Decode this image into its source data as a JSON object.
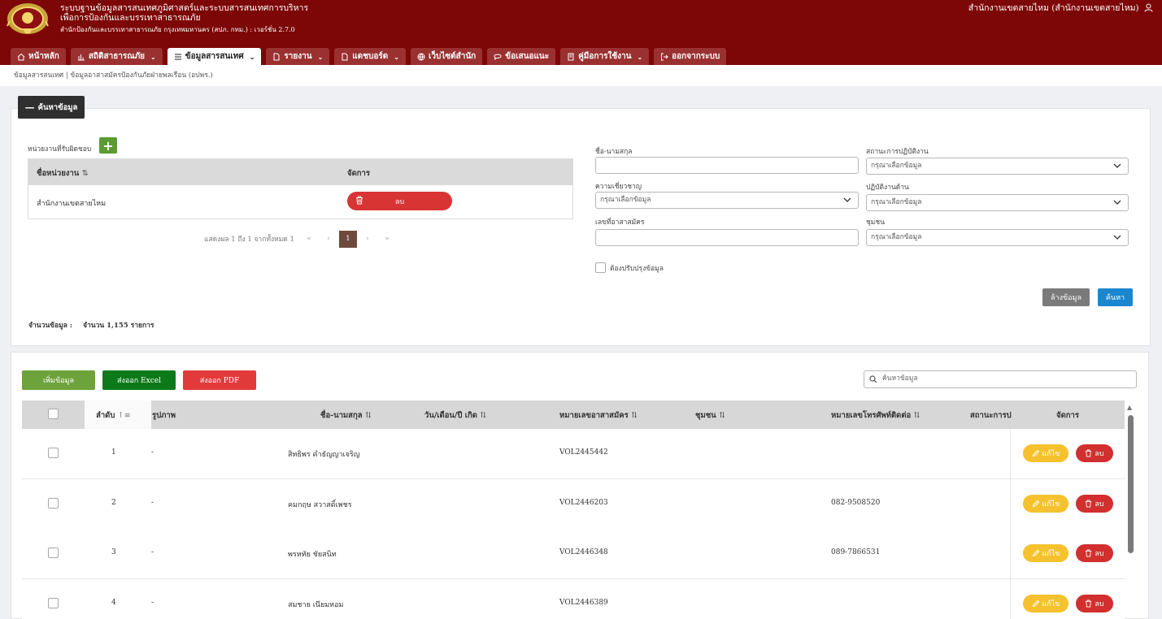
{
  "header": {
    "title_line1": "ระบบฐานข้อมูลสารสนเทศภูมิศาสตร์และระบบสารสนเทศการบริหาร",
    "title_line2": "เพื่อการป้องกันและบรรเทาสาธารณภัย",
    "subtitle": "สำนักป้องกันและบรรเทาสาธารณภัย กรุงเทพมหานคร (สปภ. กทม.) : เวอร์ชั่น 2.7.0",
    "user": "สำนักงานเขตสายไหม (สำนักงานเขตสายไหม)",
    "brand_color": "#7d0606"
  },
  "nav": [
    {
      "label": "หน้าหลัก",
      "icon": "home-icon",
      "dropdown": false,
      "active": false
    },
    {
      "label": "สถิติสาธารณภัย",
      "icon": "bar-chart-icon",
      "dropdown": true,
      "active": false
    },
    {
      "label": "ข้อมูลสารสนเทศ",
      "icon": "list-icon",
      "dropdown": true,
      "active": true
    },
    {
      "label": "รายงาน",
      "icon": "file-icon",
      "dropdown": true,
      "active": false
    },
    {
      "label": "แดชบอร์ด",
      "icon": "file-icon",
      "dropdown": true,
      "active": false
    },
    {
      "label": "เว็บไซต์สำนัก",
      "icon": "globe-icon",
      "dropdown": false,
      "active": false
    },
    {
      "label": "ข้อเสนอแนะ",
      "icon": "comment-icon",
      "dropdown": false,
      "active": false
    },
    {
      "label": "คู่มือการใช้งาน",
      "icon": "book-icon",
      "dropdown": true,
      "active": false
    },
    {
      "label": "ออกจากระบบ",
      "icon": "logout-icon",
      "dropdown": false,
      "active": false
    }
  ],
  "breadcrumb": "ข้อมูลสารสนเทศ | ข้อมูลอาสาสมัครป้องกันภัยฝ่ายพลเรือน (อปพร.)",
  "search": {
    "toggle_label": "ค้นหาข้อมูล",
    "unit_label": "หน่วยงานที่รับผิดชอบ",
    "unit_table": {
      "col_name": "ชื่อหน่วยงาน",
      "col_action": "จัดการ",
      "row_name": "สำนักงานเขตสายไหม",
      "delete_label": "ลบ"
    },
    "pager": {
      "info": "แสดงผล 1 ถึง 1 จากทั้งหมด 1",
      "first": "«",
      "prev": "‹",
      "current": "1",
      "next": "›",
      "last": "»"
    },
    "total_label": "จำนวนข้อมูล :",
    "total_value": "จำนวน 1,155 รายการ",
    "fields": {
      "name_label": "ชื่อ-นามสกุล",
      "status_label": "สถานะการปฏิบัติงาน",
      "status_placeholder": "กรุณาเลือกข้อมูล",
      "skill_label": "ความเชี่ยวชาญ",
      "skill_placeholder": "กรุณาเลือกข้อมูล",
      "duty_label": "ปฏิบัติงานด้าน",
      "duty_placeholder": "กรุณาเลือกข้อมูล",
      "volunteer_no_label": "เลขที่อาสาสมัคร",
      "community_label": "ชุมชน",
      "community_placeholder": "กรุณาเลือกข้อมูล",
      "update_checkbox_label": "ต้องปรับปรุงข้อมูล"
    },
    "clear_label": "ล้างข้อมูล",
    "search_label": "ค้นหา"
  },
  "toolbar": {
    "add_label": "เพิ่มข้อมูล",
    "excel_label": "ส่งออก Excel",
    "pdf_label": "ส่งออก PDF",
    "search_placeholder": "ค้นหาข้อมูล"
  },
  "grid": {
    "columns": {
      "order": "ลำดับ",
      "photo": "รูปภาพ",
      "name": "ชื่อ-นามสกุล",
      "birth": "วัน/เดือน/ปี เกิด",
      "vol_no": "หมายเลขอาสาสมัคร",
      "community": "ชุมชน",
      "phone": "หมายเลขโทรศัพท์ติดต่อ",
      "status": "สถานะการป",
      "action": "จัดการ"
    },
    "edit_label": "แก้ไข",
    "delete_label": "ลบ",
    "rows": [
      {
        "order": "1",
        "photo": "-",
        "name": "สิทธิพร คำธัญญาเจริญ",
        "vol_no": "VOL2445442",
        "phone": ""
      },
      {
        "order": "2",
        "photo": "-",
        "name": "คมกฤษ สวาสดิ์เพชร",
        "vol_no": "VOL2446203",
        "phone": "082-9508520"
      },
      {
        "order": "3",
        "photo": "-",
        "name": "พรหทัย ชัยสนิท",
        "vol_no": "VOL2446348",
        "phone": "089-7866531"
      },
      {
        "order": "4",
        "photo": "-",
        "name": "สมชาย เนียมหอม",
        "vol_no": "VOL2446389",
        "phone": ""
      }
    ]
  }
}
